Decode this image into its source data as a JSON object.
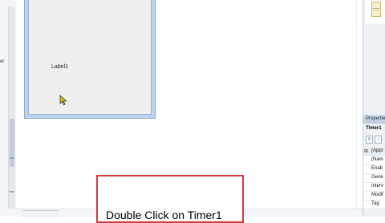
{
  "left_strip": {
    "snippet": "er"
  },
  "form": {
    "label_text": "Label1"
  },
  "callout": {
    "text": "Double Click on Timer1"
  },
  "properties": {
    "title": "Propertie",
    "object": "Timer1",
    "rows": [
      {
        "marker": "⊞",
        "name": "(Appl"
      },
      {
        "marker": "",
        "name": "(Nam"
      },
      {
        "marker": "",
        "name": "Enab"
      },
      {
        "marker": "",
        "name": "Gene"
      },
      {
        "marker": "",
        "name": "Interv"
      },
      {
        "marker": "",
        "name": "Modif"
      },
      {
        "marker": "",
        "name": "Tag"
      }
    ]
  }
}
